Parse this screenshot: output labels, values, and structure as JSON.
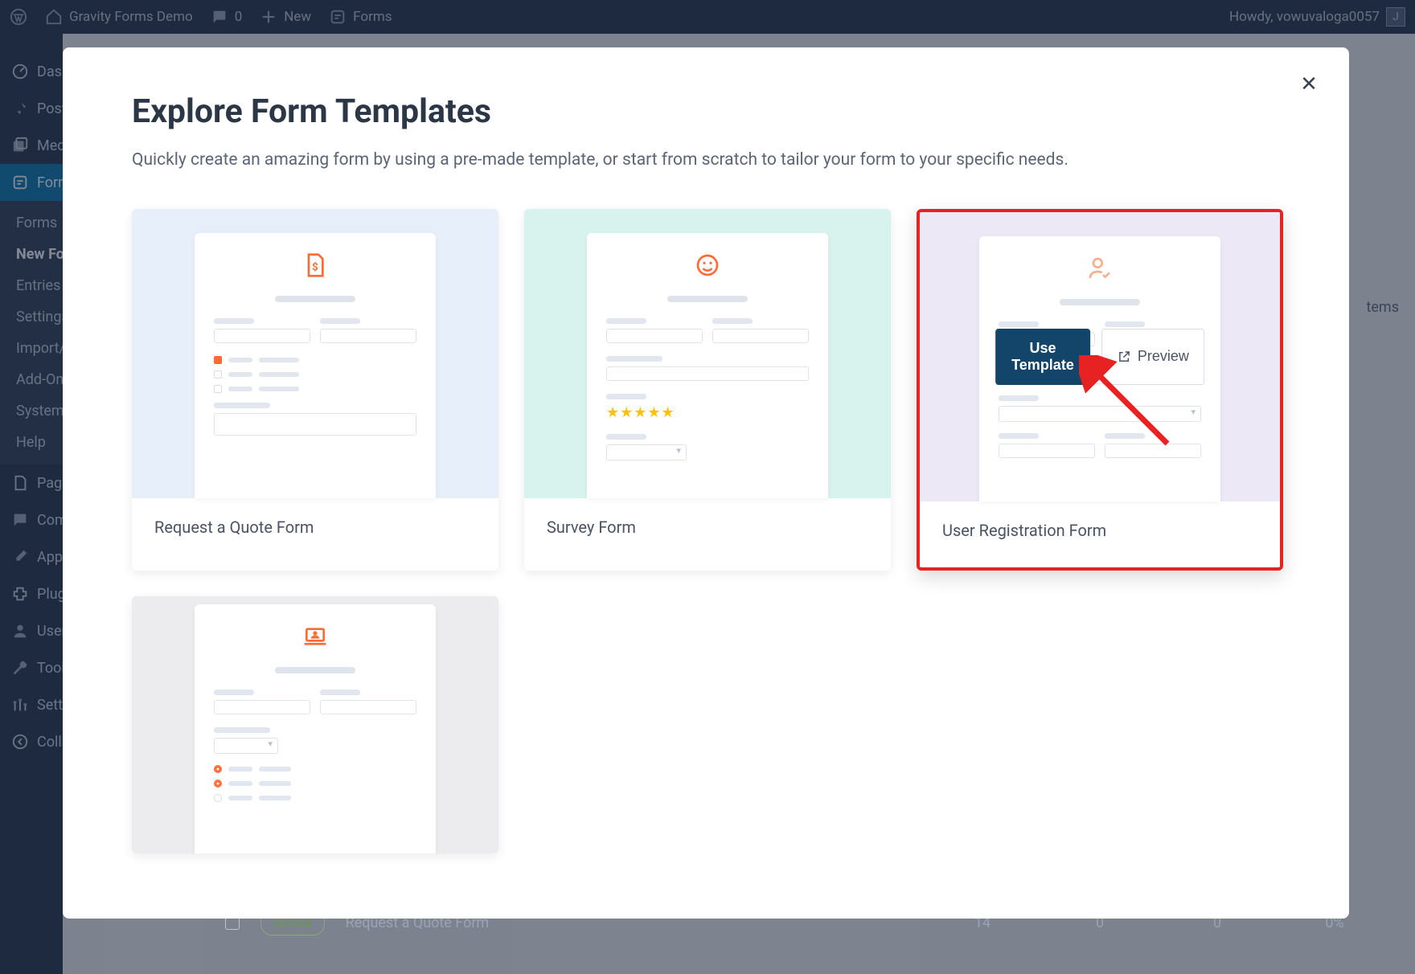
{
  "admin_bar": {
    "site_name": "Gravity Forms Demo",
    "comments": "0",
    "new_label": "New",
    "forms_label": "Forms",
    "greeting": "Howdy, vowuvaloga0057"
  },
  "sidebar": {
    "items": [
      {
        "label": "Dashboard"
      },
      {
        "label": "Posts"
      },
      {
        "label": "Media"
      },
      {
        "label": "Forms"
      },
      {
        "label": "Pages"
      },
      {
        "label": "Comments"
      },
      {
        "label": "Appearance"
      },
      {
        "label": "Plugins"
      },
      {
        "label": "Users"
      },
      {
        "label": "Tools"
      },
      {
        "label": "Settings"
      },
      {
        "label": "Collapse menu"
      }
    ],
    "submenu": [
      {
        "label": "Forms"
      },
      {
        "label": "New Form"
      },
      {
        "label": "Entries"
      },
      {
        "label": "Settings"
      },
      {
        "label": "Import/Export"
      },
      {
        "label": "Add-Ons"
      },
      {
        "label": "System Status"
      },
      {
        "label": "Help"
      }
    ]
  },
  "modal": {
    "title": "Explore Form Templates",
    "description": "Quickly create an amazing form by using a pre-made template, or start from scratch to tailor your form to your specific needs.",
    "close_label": "✕",
    "use_template_label": "Use Template",
    "preview_label": "Preview"
  },
  "templates": [
    {
      "title": "Request a Quote Form",
      "bg": "bg-blue",
      "icon": "dollar-file"
    },
    {
      "title": "Survey Form",
      "bg": "bg-teal",
      "icon": "smile"
    },
    {
      "title": "User Registration Form",
      "bg": "bg-purple",
      "icon": "user-check"
    },
    {
      "title": "",
      "bg": "bg-gray",
      "icon": "laptop-user"
    }
  ],
  "behind": {
    "items_text": "tems",
    "active_pill": "Active",
    "row_title": "Request a Quote Form",
    "v1": "14",
    "v2": "0",
    "v3": "0",
    "v4": "0%"
  }
}
